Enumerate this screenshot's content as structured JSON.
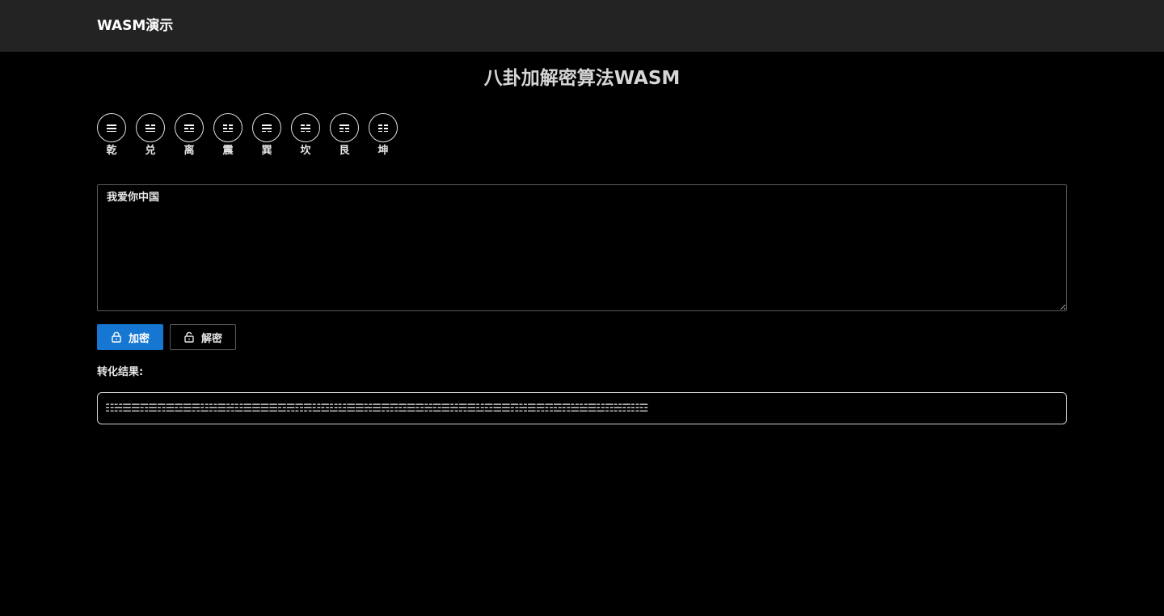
{
  "navbar": {
    "brand": "WASM演示"
  },
  "page": {
    "title": "八卦加解密算法WASM"
  },
  "trigrams": [
    {
      "label": "乾",
      "symbol": "☰",
      "icon": "qian-trigram-icon"
    },
    {
      "label": "兑",
      "symbol": "☱",
      "icon": "dui-trigram-icon"
    },
    {
      "label": "离",
      "symbol": "☲",
      "icon": "li-trigram-icon"
    },
    {
      "label": "震",
      "symbol": "☳",
      "icon": "zhen-trigram-icon"
    },
    {
      "label": "巽",
      "symbol": "☴",
      "icon": "xun-trigram-icon"
    },
    {
      "label": "坎",
      "symbol": "☵",
      "icon": "kan-trigram-icon"
    },
    {
      "label": "艮",
      "symbol": "☶",
      "icon": "gen-trigram-icon"
    },
    {
      "label": "坤",
      "symbol": "☷",
      "icon": "kun-trigram-icon"
    }
  ],
  "input": {
    "value": "我爱你中国"
  },
  "buttons": {
    "encrypt_label": "加密",
    "encrypt_icon": "lock-icon",
    "decrypt_label": "解密",
    "decrypt_icon": "unlock-icon"
  },
  "result": {
    "label": "转化结果:",
    "value": "☷☵☰☰☶☰☶☰☲☰☴☳☵☰☵☳☰☰☰☰☲☴☶☴☳☲☳☳☰☰☵☰☴☶☲☰☲☵☲☰☵☴☰☳☲☰☰☶☵☰☴☶☲☶☱☱☰☳☶☵☶☷☲"
  },
  "colors": {
    "primary": "#1677d2",
    "navbar_bg": "#232323",
    "page_bg": "#000000"
  }
}
